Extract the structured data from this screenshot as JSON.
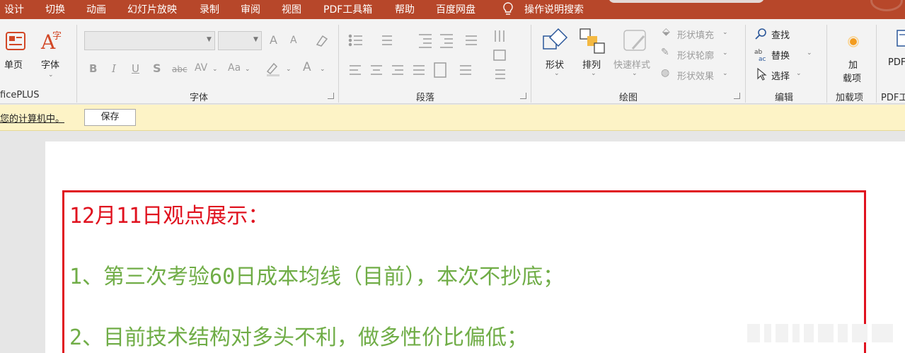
{
  "menu": {
    "items": [
      "设计",
      "切换",
      "动画",
      "幻灯片放映",
      "录制",
      "审阅",
      "视图",
      "PDF工具箱",
      "帮助",
      "百度网盘"
    ],
    "search": "操作说明搜索"
  },
  "ribbon": {
    "officeplus": {
      "btn1": "单页",
      "btn2": "字体",
      "group": "ficePLUS"
    },
    "font": {
      "group": "字体",
      "grow": "A",
      "shrink": "A",
      "bold": "B",
      "italic": "I",
      "underline": "U",
      "shadow": "S",
      "strike": "abc",
      "spacing": "AV",
      "case": "Aa",
      "color": "A"
    },
    "paragraph": {
      "group": "段落"
    },
    "drawing": {
      "group": "绘图",
      "shapes": "形状",
      "arrange": "排列",
      "quick_styles": "快速样式",
      "fill": "形状填充",
      "outline": "形状轮廓",
      "effects": "形状效果"
    },
    "editing": {
      "group": "编辑",
      "find": "查找",
      "replace": "替换",
      "select": "选择"
    },
    "addins": {
      "group": "加载项",
      "btn_line1": "加",
      "btn_line2": "载项"
    },
    "pdf": {
      "btn": "PDF",
      "group": "PDF工"
    }
  },
  "notice": {
    "message": "您的计算机中。",
    "save": "保存"
  },
  "slide": {
    "line1": "12月11日观点展示：",
    "line2": "1、第三次考验60日成本均线（目前），本次不抄底；",
    "line3": "2、目前技术结构对多头不利，做多性价比偏低；"
  },
  "colors": {
    "menu_bg": "#b7472a",
    "red_text": "#e0121f",
    "green_text": "#70ad47",
    "notice_bg": "#fdf3c6"
  }
}
